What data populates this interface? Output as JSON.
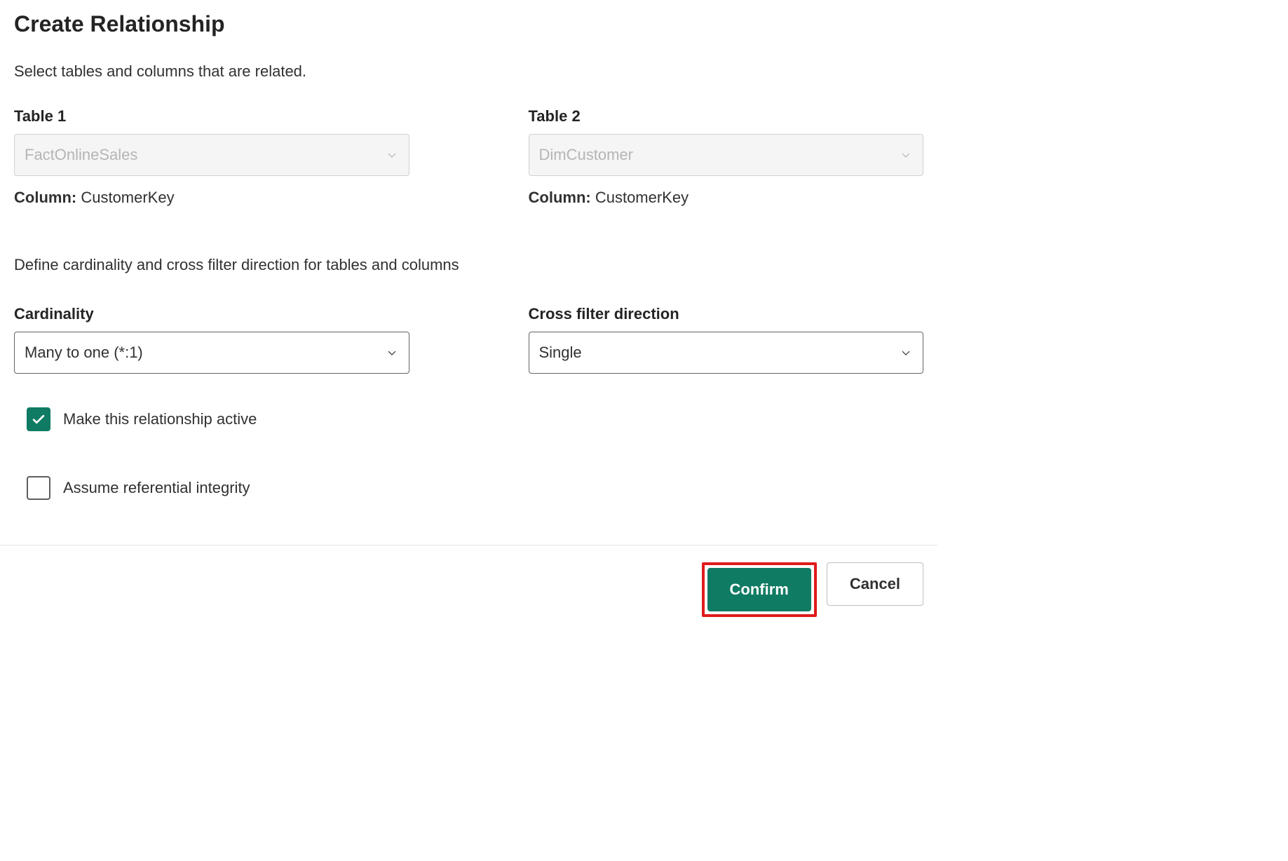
{
  "dialog": {
    "title": "Create Relationship",
    "subtitle": "Select tables and columns that are related."
  },
  "table1": {
    "label": "Table 1",
    "value": "FactOnlineSales",
    "column_label": "Column:",
    "column_value": "CustomerKey"
  },
  "table2": {
    "label": "Table 2",
    "value": "DimCustomer",
    "column_label": "Column:",
    "column_value": "CustomerKey"
  },
  "section2_subtitle": "Define cardinality and cross filter direction for tables and columns",
  "cardinality": {
    "label": "Cardinality",
    "value": "Many to one (*:1)"
  },
  "crossfilter": {
    "label": "Cross filter direction",
    "value": "Single"
  },
  "checkbox_active": {
    "label": "Make this relationship active",
    "checked": true
  },
  "checkbox_integrity": {
    "label": "Assume referential integrity",
    "checked": false
  },
  "buttons": {
    "confirm": "Confirm",
    "cancel": "Cancel"
  }
}
